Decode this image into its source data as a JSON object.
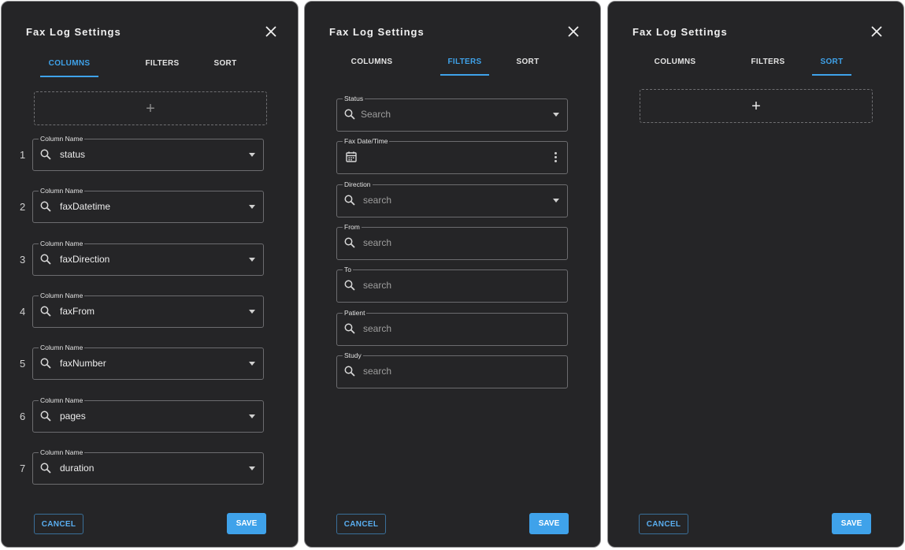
{
  "dialog_title": "Fax Log Settings",
  "tabs": {
    "columns": "COLUMNS",
    "filters": "FILTERS",
    "sort": "SORT"
  },
  "active_tab_per_panel": [
    "COLUMNS",
    "FILTERS",
    "SORT"
  ],
  "add_symbol": "+",
  "buttons": {
    "cancel": "CANCEL",
    "save": "SAVE"
  },
  "columns_panel": {
    "field_legend": "Column Name",
    "rows": [
      {
        "number": "1",
        "value": "status"
      },
      {
        "number": "2",
        "value": "faxDatetime"
      },
      {
        "number": "3",
        "value": "faxDirection"
      },
      {
        "number": "4",
        "value": "faxFrom"
      },
      {
        "number": "5",
        "value": "faxNumber"
      },
      {
        "number": "6",
        "value": "pages"
      },
      {
        "number": "7",
        "value": "duration"
      }
    ]
  },
  "filters_panel": {
    "filters": [
      {
        "label": "Status",
        "placeholder": "Search"
      },
      {
        "label": "Fax Date/Time",
        "placeholder": ""
      },
      {
        "label": "Direction",
        "placeholder": "search"
      },
      {
        "label": "From",
        "placeholder": "search"
      },
      {
        "label": "To",
        "placeholder": "search"
      },
      {
        "label": "Patient",
        "placeholder": "search"
      },
      {
        "label": "Study",
        "placeholder": "search"
      }
    ]
  },
  "colors": {
    "panel_bg": "#252527",
    "accent": "#3fa2ea",
    "field_border": "#6c6c6f",
    "text": "#e6e6e6"
  },
  "icons": [
    "close-icon",
    "add-icon",
    "search-icon",
    "chevron-down-icon",
    "calendar-icon",
    "more-vertical-icon"
  ]
}
